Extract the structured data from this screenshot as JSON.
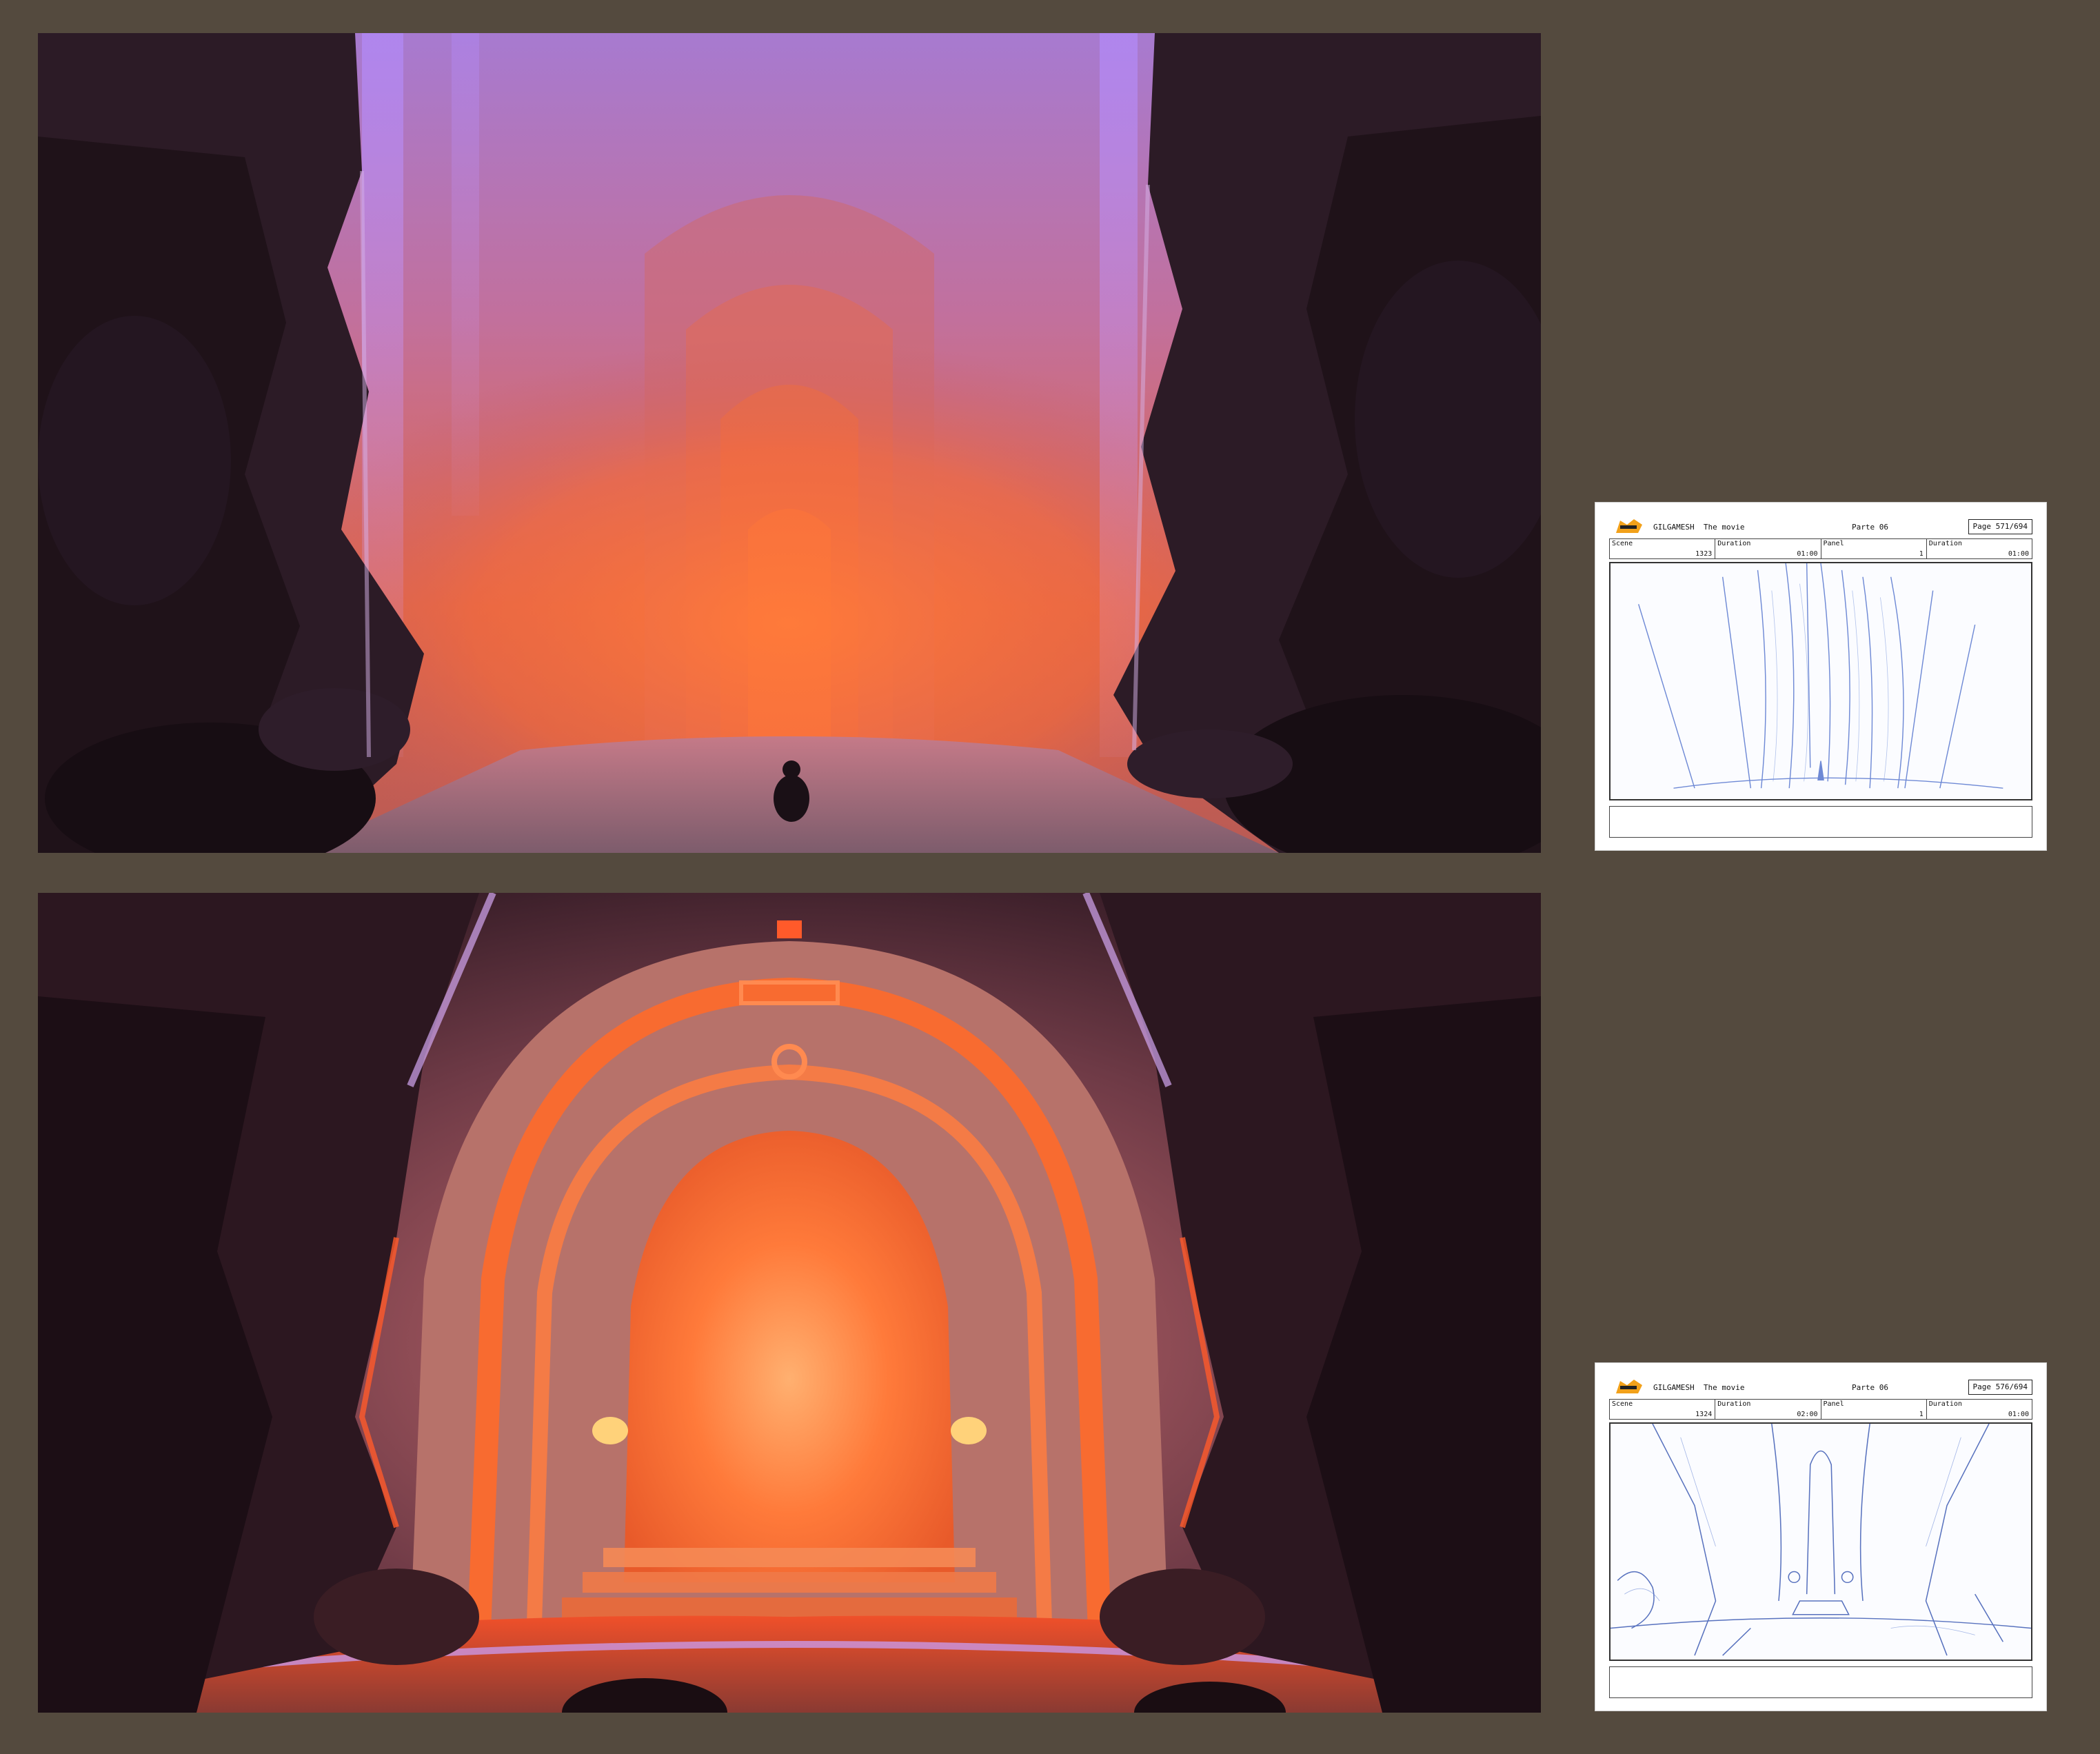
{
  "colors": {
    "background": "#544a3e",
    "sheet": "#ffffff",
    "glow": "#ff6a2a",
    "haze": "#b58bd8",
    "rock": "#2a1b24",
    "sketch": "#3f63c7"
  },
  "storyboards": [
    {
      "title": "GILGAMESH  The movie",
      "parte": "Parte 06",
      "page": "Page 571/694",
      "scene_label": "Scene",
      "scene_value": "1323",
      "duration_label": "Duration",
      "duration_value": "01:00",
      "panel_label": "Panel",
      "panel_value": "1",
      "panel_duration_label": "Duration",
      "panel_duration_value": "01:00"
    },
    {
      "title": "GILGAMESH  The movie",
      "parte": "Parte 06",
      "page": "Page 576/694",
      "scene_label": "Scene",
      "scene_value": "1324",
      "duration_label": "Duration",
      "duration_value": "02:00",
      "panel_label": "Panel",
      "panel_value": "1",
      "panel_duration_label": "Duration",
      "panel_duration_value": "01:00"
    }
  ]
}
